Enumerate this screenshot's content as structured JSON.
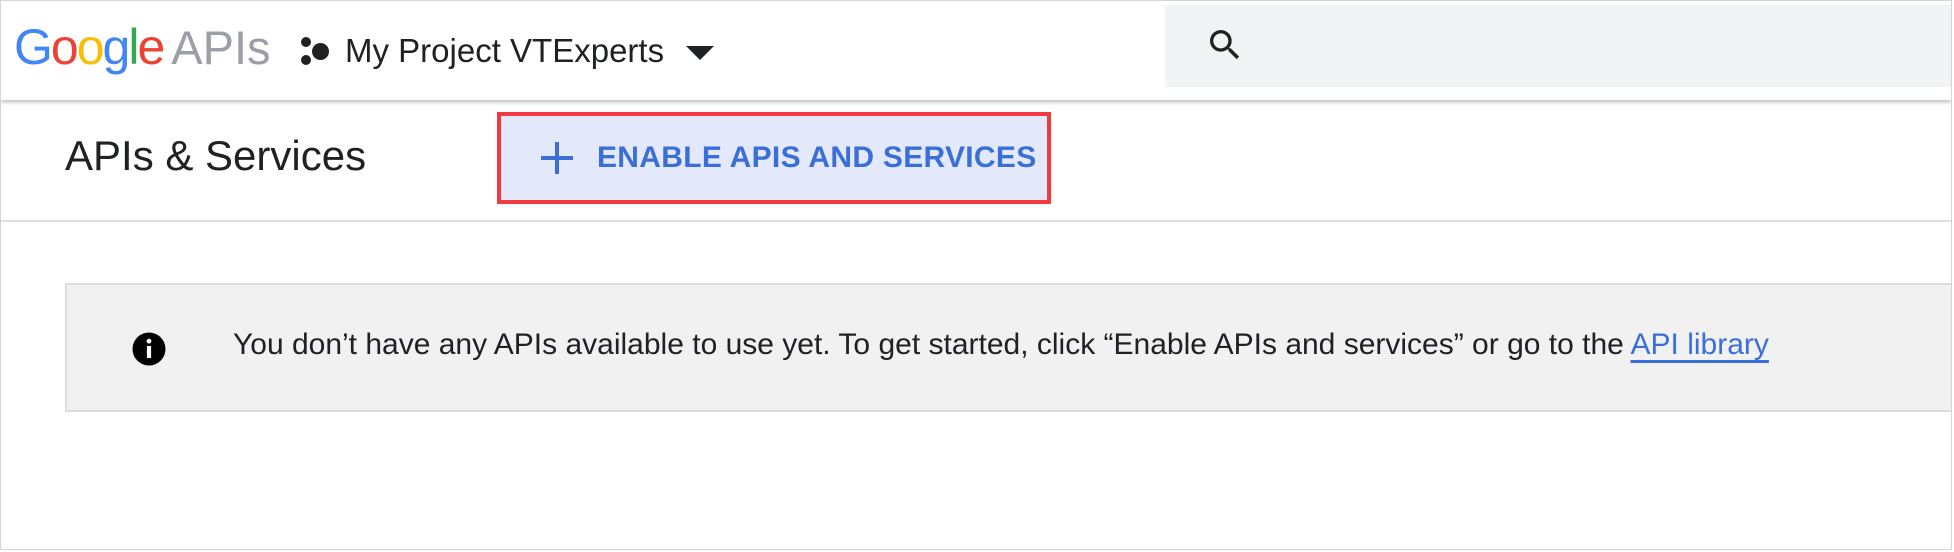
{
  "topbar": {
    "logo": {
      "google_letters": [
        "G",
        "o",
        "o",
        "g",
        "l",
        "e"
      ],
      "google_colors": [
        "#4285f4",
        "#ea4335",
        "#fbbc05",
        "#4285f4",
        "#34a853",
        "#ea4335"
      ],
      "product": "APIs"
    },
    "project": {
      "icon": "project-dots-icon",
      "name": "My Project VTExperts",
      "dropdown_icon": "caret-down-icon"
    },
    "search": {
      "icon": "search-icon",
      "placeholder": ""
    }
  },
  "header": {
    "title": "APIs & Services",
    "enable_button": {
      "icon": "plus-icon",
      "label": "ENABLE APIS AND SERVICES",
      "highlight_color": "#f2393f"
    }
  },
  "banner": {
    "icon": "info-icon",
    "message": "You don’t have any APIs available to use yet. To get started, click “Enable APIs and services” or go to the ",
    "link_label": "API library"
  },
  "colors": {
    "accent_blue": "#3b6fd8",
    "text": "#202124",
    "banner_bg": "#f1f1f1"
  }
}
